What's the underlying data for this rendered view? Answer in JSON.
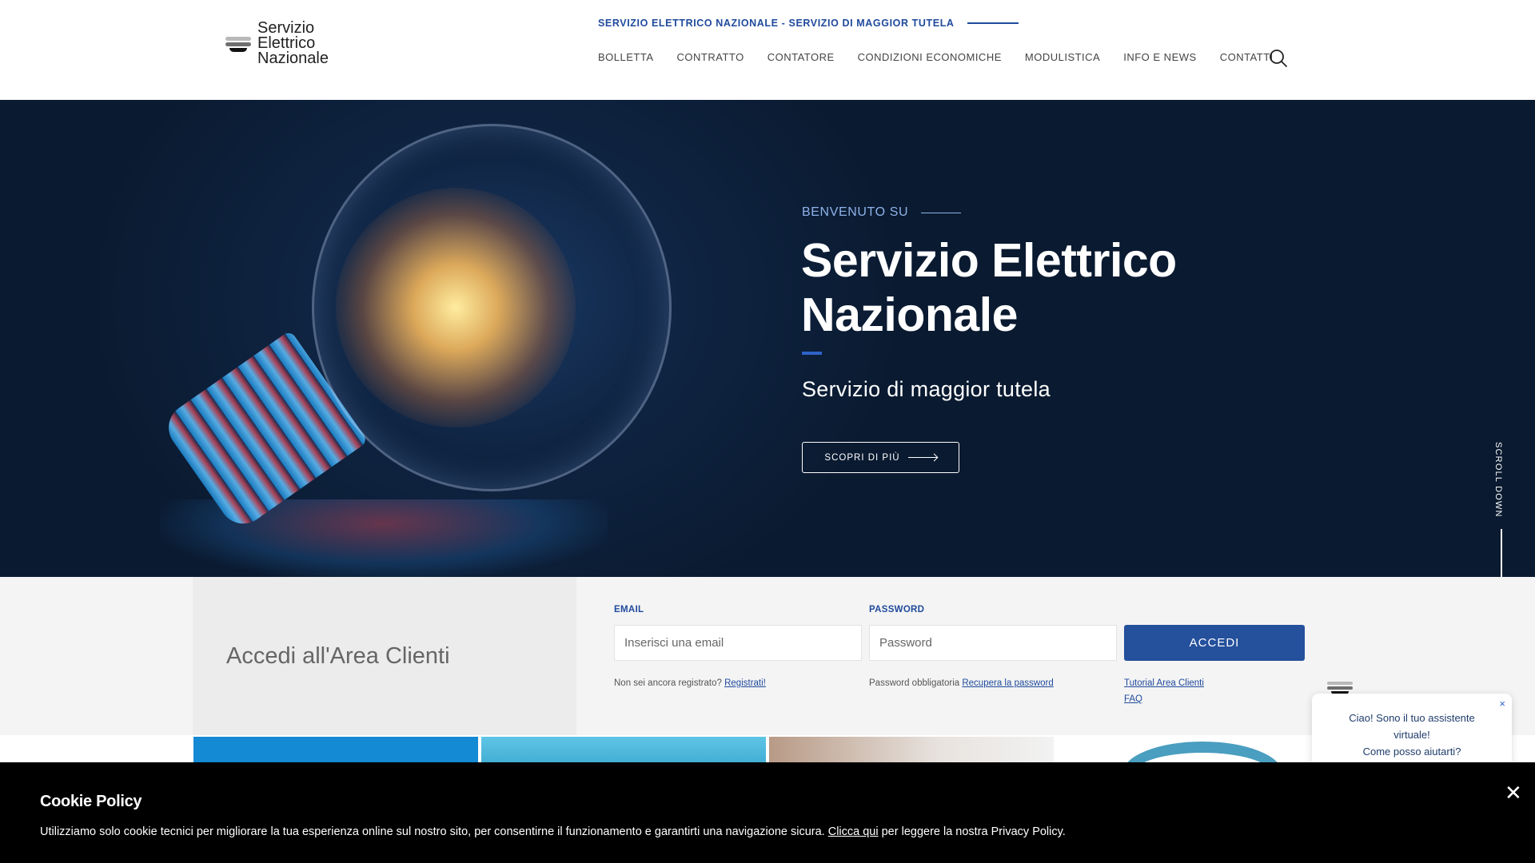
{
  "header": {
    "logo_lines": [
      "Servizio",
      "Elettrico",
      "Nazionale"
    ],
    "tagline": "SERVIZIO ELETTRICO NAZIONALE - SERVIZIO DI MAGGIOR TUTELA",
    "nav": [
      "BOLLETTA",
      "CONTRATTO",
      "CONTATORE",
      "CONDIZIONI ECONOMICHE",
      "MODULISTICA",
      "INFO E NEWS",
      "CONTATTI"
    ],
    "search_icon": "search-icon"
  },
  "hero": {
    "eyebrow": "BENVENUTO SU",
    "title_line1": "Servizio Elettrico",
    "title_line2": "Nazionale",
    "subtitle": "Servizio di maggior tutela",
    "cta": "SCOPRI DI PIÙ",
    "scroll": "SCROLL DOWN"
  },
  "login": {
    "heading": "Accedi all'Area Clienti",
    "email_label": "EMAIL",
    "email_placeholder": "Inserisci una email",
    "password_label": "PASSWORD",
    "password_placeholder": "Password",
    "submit": "ACCEDI",
    "register_prompt": "Non sei ancora registrato?",
    "register_link": "Registrati!",
    "password_note": "Password obbligatoria",
    "recover_link": "Recupera la password",
    "tutorial_link": "Tutorial Area Clienti",
    "faq_link": "FAQ"
  },
  "chat": {
    "line1": "Ciao! Sono il tuo assistente",
    "line2": "virtuale!",
    "line3": "Come posso aiutarti?",
    "close": "×"
  },
  "cookie": {
    "title": "Cookie Policy",
    "text_before": "Utilizziamo solo cookie tecnici per migliorare la tua esperienza online sul nostro sito, per consentirne il funzionamento e garantirti una navigazione sicura.",
    "link": "Clicca qui",
    "text_after": "per leggere la nostra Privacy Policy.",
    "close": "✕"
  },
  "colors": {
    "brand_blue": "#24509c",
    "accent_blue": "#2d63c8",
    "hero_bg": "#0f2442"
  }
}
